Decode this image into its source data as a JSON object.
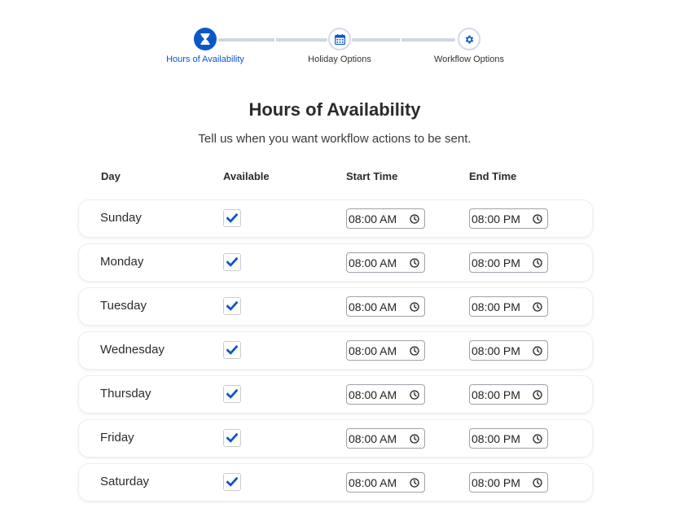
{
  "stepper": {
    "steps": [
      {
        "label": "Hours of Availability",
        "icon": "hourglass-icon",
        "active": true
      },
      {
        "label": "Holiday Options",
        "icon": "calendar-icon",
        "active": false
      },
      {
        "label": "Workflow Options",
        "icon": "gear-icon",
        "active": false
      }
    ]
  },
  "header": {
    "title": "Hours of Availability",
    "subtitle": "Tell us when you want workflow actions to be sent."
  },
  "table": {
    "columns": [
      "Day",
      "Available",
      "Start Time",
      "End Time"
    ],
    "rows": [
      {
        "day": "Sunday",
        "available": true,
        "start": "08:00 AM",
        "end": "08:00 PM"
      },
      {
        "day": "Monday",
        "available": true,
        "start": "08:00 AM",
        "end": "08:00 PM"
      },
      {
        "day": "Tuesday",
        "available": true,
        "start": "08:00 AM",
        "end": "08:00 PM"
      },
      {
        "day": "Wednesday",
        "available": true,
        "start": "08:00 AM",
        "end": "08:00 PM"
      },
      {
        "day": "Thursday",
        "available": true,
        "start": "08:00 AM",
        "end": "08:00 PM"
      },
      {
        "day": "Friday",
        "available": true,
        "start": "08:00 AM",
        "end": "08:00 PM"
      },
      {
        "day": "Saturday",
        "available": true,
        "start": "08:00 AM",
        "end": "08:00 PM"
      }
    ]
  },
  "colors": {
    "accent": "#0b57c9",
    "step_line": "#cfd6e2"
  }
}
